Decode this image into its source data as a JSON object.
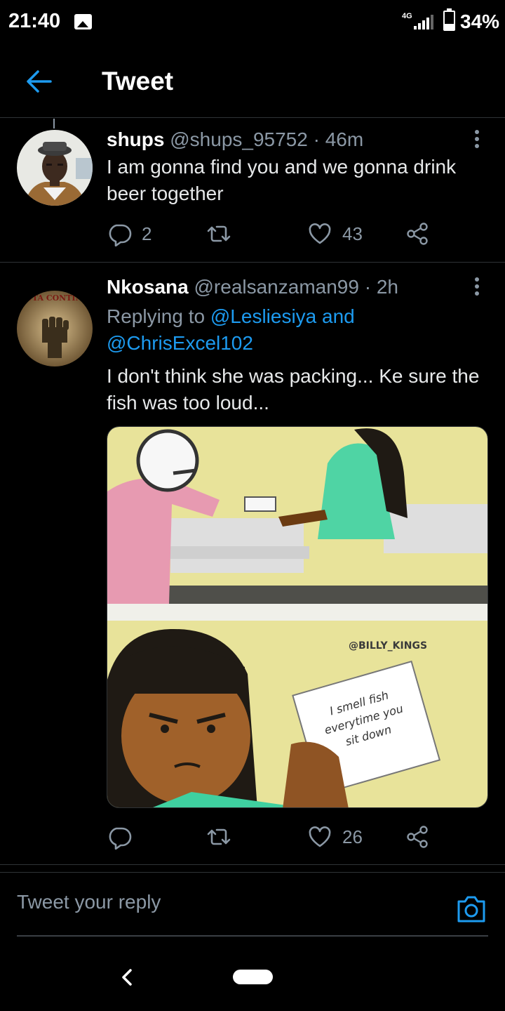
{
  "status_bar": {
    "time": "21:40",
    "network": "4G",
    "battery": "34%",
    "battery_level": 0.34
  },
  "header": {
    "title": "Tweet"
  },
  "tweets": [
    {
      "name": "shups",
      "meta": "@shups_95752 · 46m",
      "text": "I am gonna find you and we gonna drink beer together",
      "reply_count": "2",
      "like_count": "43"
    },
    {
      "name": "Nkosana",
      "meta": "@realsanzaman99 · 2h",
      "avatar_text": "ALUTA CONTINUA",
      "replying_prefix": "Replying to",
      "mention_1": "@Lesliesiya",
      "replying_and": "and",
      "mention_2": "@ChrisExcel102",
      "text": "I don't think she was packing... Ke sure the fish was too loud...",
      "media": {
        "watermark": "@BILLY_KINGS",
        "note_line_1": "I smell fish",
        "note_line_2": "everytime you",
        "note_line_3": "sit down"
      },
      "like_count": "26"
    }
  ],
  "compose": {
    "placeholder": "Tweet your reply"
  },
  "colors": {
    "accent": "#1d9bf0",
    "secondary_text": "#8b98a5",
    "divider": "#2f3336",
    "background": "#000000"
  },
  "icons": [
    "back-arrow-icon",
    "more-vert-icon",
    "reply-icon",
    "retweet-icon",
    "like-icon",
    "share-icon",
    "camera-icon"
  ]
}
